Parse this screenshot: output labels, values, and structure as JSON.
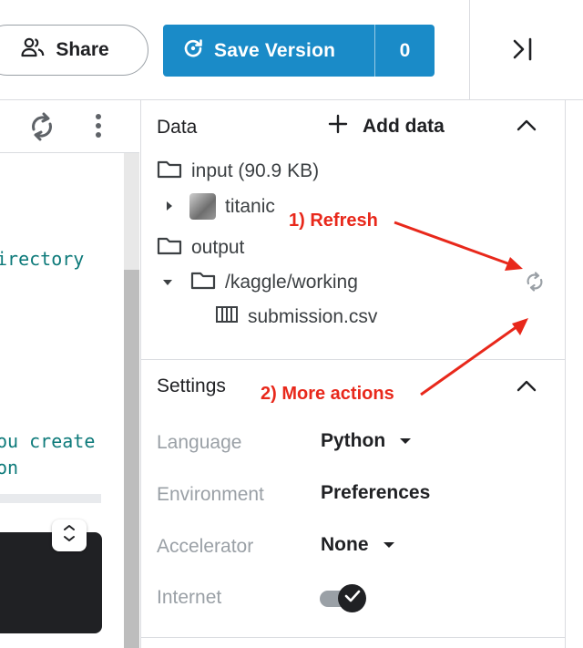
{
  "topbar": {
    "share_label": "Share",
    "save_label": "Save Version",
    "version_count": "0"
  },
  "editor": {
    "code_lines": [
      "irectory",
      "ou create",
      "on"
    ]
  },
  "data_section": {
    "title": "Data",
    "add_label": "Add data",
    "input_label": "input (90.9 KB)",
    "dataset_name": "titanic",
    "output_label": "output",
    "working_dir": "/kaggle/working",
    "file_name": "submission.csv"
  },
  "settings_section": {
    "title": "Settings",
    "rows": [
      {
        "label": "Language",
        "value": "Python"
      },
      {
        "label": "Environment",
        "value": "Preferences"
      },
      {
        "label": "Accelerator",
        "value": "None"
      },
      {
        "label": "Internet",
        "value": "on"
      }
    ]
  },
  "annotations": {
    "refresh": "1) Refresh",
    "more_actions": "2) More actions"
  },
  "colors": {
    "primary_button": "#1a8bc8",
    "annotation": "#e8281b",
    "code_text": "#0d7a7a"
  },
  "icons": {
    "share": "people-icon",
    "save": "save-refresh-icon",
    "collapse": "collapse-right-icon",
    "editor_refresh": "cycle-icon",
    "more": "kebab-icon",
    "folder": "folder-icon",
    "file": "csv-table-icon",
    "data_refresh": "refresh-icon"
  }
}
